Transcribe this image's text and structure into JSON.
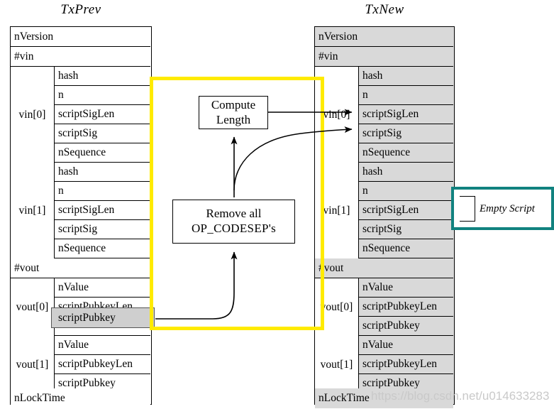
{
  "diagram": {
    "title_left": "TxPrev",
    "title_right": "TxNew",
    "watermark": "https://blog.csdn.net/u014633283"
  },
  "tx_prev": {
    "name": "TxPrev",
    "rows": [
      {
        "label": "",
        "field": "nVersion",
        "span": "full"
      },
      {
        "label": "",
        "field": "#vin",
        "span": "full"
      }
    ],
    "groups": [
      {
        "label": "vin[0]",
        "fields": [
          "hash",
          "n",
          "scriptSigLen",
          "scriptSig",
          "nSequence"
        ]
      },
      {
        "label": "vin[1]",
        "fields": [
          "hash",
          "n",
          "scriptSigLen",
          "scriptSig",
          "nSequence"
        ]
      },
      {
        "label": "vout[0]",
        "fields": [
          "nValue",
          "scriptPubkeyLen",
          "scriptPubkey"
        ]
      },
      {
        "label": "vout[1]",
        "fields": [
          "nValue",
          "scriptPubkeyLen",
          "scriptPubkey"
        ]
      }
    ],
    "row_nversion": "nVersion",
    "row_nvin": "#vin",
    "row_nvout": "#vout",
    "row_nlocktime": "nLockTime",
    "highlighted_field": "scriptPubkey"
  },
  "tx_new": {
    "name": "TxNew",
    "row_nversion": "nVersion",
    "row_nvin": "#vin",
    "row_nvout": "#vout",
    "row_nlocktime": "nLockTime",
    "groups": [
      {
        "label": "vin[0]",
        "fields": [
          "hash",
          "n",
          "scriptSigLen",
          "scriptSig",
          "nSequence"
        ]
      },
      {
        "label": "vin[1]",
        "fields": [
          "hash",
          "n",
          "scriptSigLen",
          "scriptSig",
          "nSequence"
        ]
      },
      {
        "label": "vout[0]",
        "fields": [
          "nValue",
          "scriptPubkeyLen",
          "scriptPubkey"
        ]
      },
      {
        "label": "vout[1]",
        "fields": [
          "nValue",
          "scriptPubkeyLen",
          "scriptPubkey"
        ]
      }
    ]
  },
  "process": {
    "compute_length_line1": "Compute",
    "compute_length_line2": "Length",
    "remove_codesep_line1": "Remove all",
    "remove_codesep_line2": "OP_CODESEP's"
  },
  "callout": {
    "empty_script": "Empty Script"
  },
  "colors": {
    "yellow_highlight": "#ffeb00",
    "teal_callout": "#11827f",
    "table_fill_gray": "#d9d9d9",
    "row_highlight_gray": "#cfcfcf",
    "stroke": "#000000",
    "watermark": "#c9c9c9"
  }
}
